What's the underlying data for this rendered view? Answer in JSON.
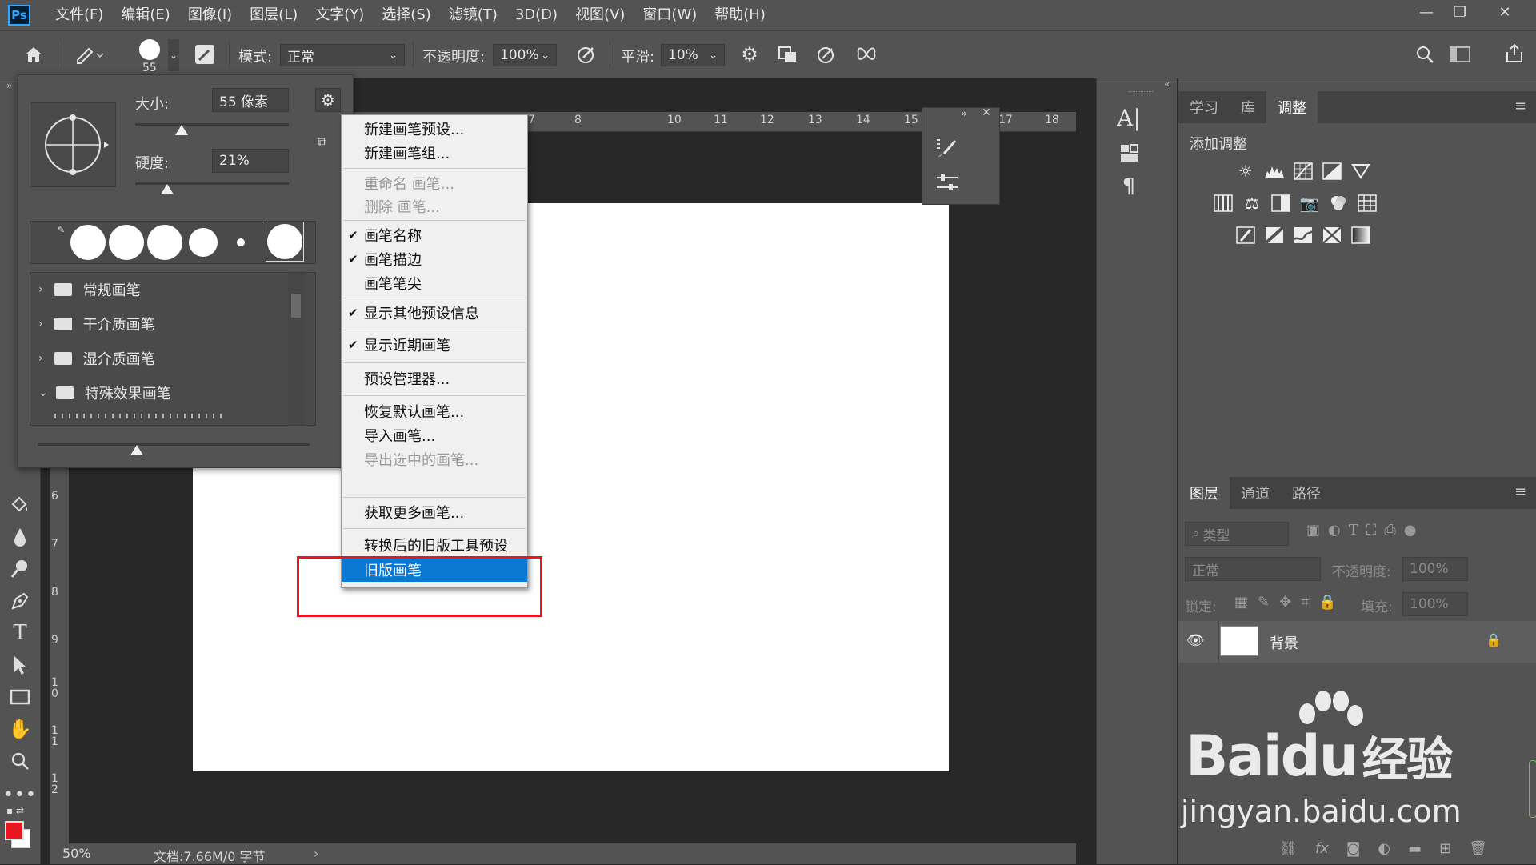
{
  "app": {
    "logo_text": "Ps"
  },
  "menubar": {
    "items": [
      "文件(F)",
      "编辑(E)",
      "图像(I)",
      "图层(L)",
      "文字(Y)",
      "选择(S)",
      "滤镜(T)",
      "3D(D)",
      "视图(V)",
      "窗口(W)",
      "帮助(H)"
    ],
    "window_buttons": {
      "minimize": "—",
      "restore": "❐",
      "close": "✕"
    }
  },
  "options_bar": {
    "brush_size_preview": "55",
    "mode_label": "模式:",
    "mode_value": "正常",
    "opacity_label": "不透明度:",
    "opacity_value": "100%",
    "smoothing_label": "平滑:",
    "smoothing_value": "10%"
  },
  "ruler": {
    "top_ticks": [
      "7",
      "8",
      "10",
      "11",
      "12",
      "13",
      "14",
      "15",
      "17",
      "18"
    ],
    "left_ticks": [
      "6",
      "7",
      "8",
      "9",
      "1 0",
      "1 1",
      "1 2"
    ]
  },
  "status": {
    "zoom": "50%",
    "doc_info": "文档:7.66M/0 字节"
  },
  "brush_panel": {
    "size_label": "大小:",
    "size_value": "55 像素",
    "hardness_label": "硬度:",
    "hardness_value": "21%",
    "size_fraction": 0.3,
    "hardness_fraction": 0.21,
    "folders": [
      {
        "label": "常规画笔",
        "expanded": false
      },
      {
        "label": "干介质画笔",
        "expanded": false
      },
      {
        "label": "湿介质画笔",
        "expanded": false
      },
      {
        "label": "特殊效果画笔",
        "expanded": true
      }
    ]
  },
  "context_menu": {
    "items": [
      {
        "label": "新建画笔预设...",
        "disabled": false,
        "checked": false,
        "highlighted": false
      },
      {
        "label": "新建画笔组...",
        "disabled": false,
        "checked": false,
        "highlighted": false
      },
      {
        "label": "重命名 画笔...",
        "disabled": true,
        "checked": false,
        "highlighted": false
      },
      {
        "label": "删除 画笔...",
        "disabled": true,
        "checked": false,
        "highlighted": false
      },
      {
        "label": "画笔名称",
        "disabled": false,
        "checked": true,
        "highlighted": false
      },
      {
        "label": "画笔描边",
        "disabled": false,
        "checked": true,
        "highlighted": false
      },
      {
        "label": "画笔笔尖",
        "disabled": false,
        "checked": false,
        "highlighted": false
      },
      {
        "label": "显示其他预设信息",
        "disabled": false,
        "checked": true,
        "highlighted": false
      },
      {
        "label": "显示近期画笔",
        "disabled": false,
        "checked": true,
        "highlighted": false
      },
      {
        "label": "预设管理器...",
        "disabled": false,
        "checked": false,
        "highlighted": false
      },
      {
        "label": "恢复默认画笔...",
        "disabled": false,
        "checked": false,
        "highlighted": false
      },
      {
        "label": "导入画笔...",
        "disabled": false,
        "checked": false,
        "highlighted": false
      },
      {
        "label": "导出选中的画笔...",
        "disabled": true,
        "checked": false,
        "highlighted": false
      },
      {
        "label": "获取更多画笔...",
        "disabled": false,
        "checked": false,
        "highlighted": false
      },
      {
        "label": "转换后的旧版工具预设",
        "disabled": false,
        "checked": false,
        "highlighted": false
      },
      {
        "label": "旧版画笔",
        "disabled": false,
        "checked": false,
        "highlighted": true
      }
    ],
    "check_glyph": "✔"
  },
  "right_panel": {
    "top_tabs": [
      "学习",
      "库",
      "调整"
    ],
    "active_top_tab": "调整",
    "adjust_header": "添加调整",
    "layer_tabs": [
      "图层",
      "通道",
      "路径"
    ],
    "active_layer_tab": "图层",
    "filter_placeholder": "类型",
    "blend_mode": "正常",
    "opacity_label": "不透明度:",
    "opacity_value": "100%",
    "lock_label": "锁定:",
    "fill_label": "填充:",
    "fill_value": "100%",
    "layer_name": "背景"
  },
  "watermark": {
    "brand": "Bai",
    "brand_du": "du",
    "brand_cn": "经验",
    "url": "jingyan.baidu.com"
  },
  "colors": {
    "foreground": "#e8161d",
    "background": "#ffffff",
    "highlight": "#0b78d4",
    "annotation": "#e8161d"
  }
}
